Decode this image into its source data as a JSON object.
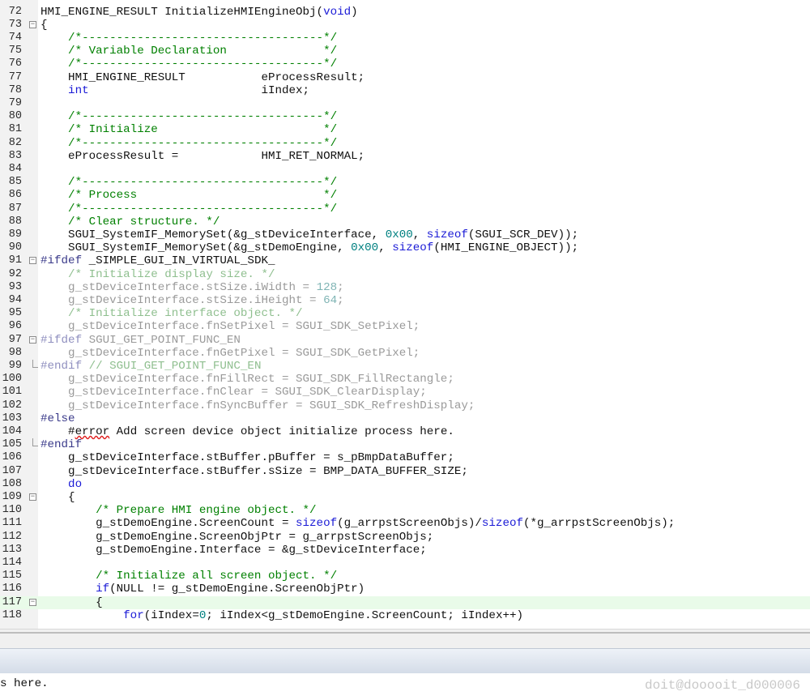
{
  "editor": {
    "first_line": 72,
    "current_line": 117,
    "lines": [
      {
        "n": "72",
        "fold": "none",
        "tokens": [
          [
            "t",
            "HMI_ENGINE_RESULT InitializeHMIEngineObj("
          ],
          [
            "k",
            "void"
          ],
          [
            "t",
            ")"
          ]
        ]
      },
      {
        "n": "73",
        "fold": "open",
        "tokens": [
          [
            "t",
            "{"
          ]
        ]
      },
      {
        "n": "74",
        "fold": "none",
        "tokens": [
          [
            "c",
            "    /*-----------------------------------*/"
          ]
        ]
      },
      {
        "n": "75",
        "fold": "none",
        "tokens": [
          [
            "c",
            "    /* Variable Declaration              */"
          ]
        ]
      },
      {
        "n": "76",
        "fold": "none",
        "tokens": [
          [
            "c",
            "    /*-----------------------------------*/"
          ]
        ]
      },
      {
        "n": "77",
        "fold": "none",
        "tokens": [
          [
            "t",
            "    HMI_ENGINE_RESULT           eProcessResult;"
          ]
        ]
      },
      {
        "n": "78",
        "fold": "none",
        "tokens": [
          [
            "k",
            "    int"
          ],
          [
            "t",
            "                         iIndex;"
          ]
        ]
      },
      {
        "n": "79",
        "fold": "none",
        "tokens": []
      },
      {
        "n": "80",
        "fold": "none",
        "tokens": [
          [
            "c",
            "    /*-----------------------------------*/"
          ]
        ]
      },
      {
        "n": "81",
        "fold": "none",
        "tokens": [
          [
            "c",
            "    /* Initialize                        */"
          ]
        ]
      },
      {
        "n": "82",
        "fold": "none",
        "tokens": [
          [
            "c",
            "    /*-----------------------------------*/"
          ]
        ]
      },
      {
        "n": "83",
        "fold": "none",
        "tokens": [
          [
            "t",
            "    eProcessResult =            HMI_RET_NORMAL;"
          ]
        ]
      },
      {
        "n": "84",
        "fold": "none",
        "tokens": []
      },
      {
        "n": "85",
        "fold": "none",
        "tokens": [
          [
            "c",
            "    /*-----------------------------------*/"
          ]
        ]
      },
      {
        "n": "86",
        "fold": "none",
        "tokens": [
          [
            "c",
            "    /* Process                           */"
          ]
        ]
      },
      {
        "n": "87",
        "fold": "none",
        "tokens": [
          [
            "c",
            "    /*-----------------------------------*/"
          ]
        ]
      },
      {
        "n": "88",
        "fold": "none",
        "tokens": [
          [
            "c",
            "    /* Clear structure. */"
          ]
        ]
      },
      {
        "n": "89",
        "fold": "none",
        "tokens": [
          [
            "t",
            "    SGUI_SystemIF_MemorySet(&g_stDeviceInterface, "
          ],
          [
            "n",
            "0x00"
          ],
          [
            "t",
            ", "
          ],
          [
            "k",
            "sizeof"
          ],
          [
            "t",
            "(SGUI_SCR_DEV));"
          ]
        ]
      },
      {
        "n": "90",
        "fold": "none",
        "tokens": [
          [
            "t",
            "    SGUI_SystemIF_MemorySet(&g_stDemoEngine, "
          ],
          [
            "n",
            "0x00"
          ],
          [
            "t",
            ", "
          ],
          [
            "k",
            "sizeof"
          ],
          [
            "t",
            "(HMI_ENGINE_OBJECT));"
          ]
        ]
      },
      {
        "n": "91",
        "fold": "open",
        "tokens": [
          [
            "p",
            "#ifdef"
          ],
          [
            "t",
            " _SIMPLE_GUI_IN_VIRTUAL_SDK_"
          ]
        ]
      },
      {
        "n": "92",
        "fold": "none",
        "tokens": [
          [
            "gc",
            "    /* Initialize display size. */"
          ]
        ]
      },
      {
        "n": "93",
        "fold": "none",
        "tokens": [
          [
            "g",
            "    g_stDeviceInterface.stSize.iWidth = "
          ],
          [
            "gn",
            "128"
          ],
          [
            "g",
            ";"
          ]
        ]
      },
      {
        "n": "94",
        "fold": "none",
        "tokens": [
          [
            "g",
            "    g_stDeviceInterface.stSize.iHeight = "
          ],
          [
            "gn",
            "64"
          ],
          [
            "g",
            ";"
          ]
        ]
      },
      {
        "n": "95",
        "fold": "none",
        "tokens": [
          [
            "gc",
            "    /* Initialize interface object. */"
          ]
        ]
      },
      {
        "n": "96",
        "fold": "none",
        "tokens": [
          [
            "g",
            "    g_stDeviceInterface.fnSetPixel = SGUI_SDK_SetPixel;"
          ]
        ]
      },
      {
        "n": "97",
        "fold": "open",
        "tokens": [
          [
            "gp",
            "#ifdef"
          ],
          [
            "g",
            " SGUI_GET_POINT_FUNC_EN"
          ]
        ]
      },
      {
        "n": "98",
        "fold": "none",
        "tokens": [
          [
            "g",
            "    g_stDeviceInterface.fnGetPixel = SGUI_SDK_GetPixel;"
          ]
        ]
      },
      {
        "n": "99",
        "fold": "end",
        "tokens": [
          [
            "gp",
            "#endif"
          ],
          [
            "gc",
            " // SGUI_GET_POINT_FUNC_EN"
          ]
        ]
      },
      {
        "n": "100",
        "fold": "none",
        "tokens": [
          [
            "g",
            "    g_stDeviceInterface.fnFillRect = SGUI_SDK_FillRectangle;"
          ]
        ]
      },
      {
        "n": "101",
        "fold": "none",
        "tokens": [
          [
            "g",
            "    g_stDeviceInterface.fnClear = SGUI_SDK_ClearDisplay;"
          ]
        ]
      },
      {
        "n": "102",
        "fold": "none",
        "tokens": [
          [
            "g",
            "    g_stDeviceInterface.fnSyncBuffer = SGUI_SDK_RefreshDisplay;"
          ]
        ]
      },
      {
        "n": "103",
        "fold": "none",
        "tokens": [
          [
            "p",
            "#else"
          ]
        ]
      },
      {
        "n": "104",
        "fold": "none",
        "tokens": [
          [
            "t",
            "    #"
          ],
          [
            "err",
            "error"
          ],
          [
            "t",
            " Add screen device object initialize process here."
          ]
        ]
      },
      {
        "n": "105",
        "fold": "end",
        "tokens": [
          [
            "p",
            "#endif"
          ]
        ]
      },
      {
        "n": "106",
        "fold": "none",
        "tokens": [
          [
            "t",
            "    g_stDeviceInterface.stBuffer.pBuffer = s_pBmpDataBuffer;"
          ]
        ]
      },
      {
        "n": "107",
        "fold": "none",
        "tokens": [
          [
            "t",
            "    g_stDeviceInterface.stBuffer.sSize = BMP_DATA_BUFFER_SIZE;"
          ]
        ]
      },
      {
        "n": "108",
        "fold": "none",
        "tokens": [
          [
            "k",
            "    do"
          ]
        ]
      },
      {
        "n": "109",
        "fold": "open",
        "tokens": [
          [
            "t",
            "    {"
          ]
        ]
      },
      {
        "n": "110",
        "fold": "none",
        "tokens": [
          [
            "c",
            "        /* Prepare HMI engine object. */"
          ]
        ]
      },
      {
        "n": "111",
        "fold": "none",
        "tokens": [
          [
            "t",
            "        g_stDemoEngine.ScreenCount = "
          ],
          [
            "k",
            "sizeof"
          ],
          [
            "t",
            "(g_arrpstScreenObjs)/"
          ],
          [
            "k",
            "sizeof"
          ],
          [
            "t",
            "(*g_arrpstScreenObjs);"
          ]
        ]
      },
      {
        "n": "112",
        "fold": "none",
        "tokens": [
          [
            "t",
            "        g_stDemoEngine.ScreenObjPtr = g_arrpstScreenObjs;"
          ]
        ]
      },
      {
        "n": "113",
        "fold": "none",
        "tokens": [
          [
            "t",
            "        g_stDemoEngine.Interface = &g_stDeviceInterface;"
          ]
        ]
      },
      {
        "n": "114",
        "fold": "none",
        "tokens": []
      },
      {
        "n": "115",
        "fold": "none",
        "tokens": [
          [
            "c",
            "        /* Initialize all screen object. */"
          ]
        ]
      },
      {
        "n": "116",
        "fold": "none",
        "tokens": [
          [
            "k",
            "        if"
          ],
          [
            "t",
            "(NULL != g_stDemoEngine.ScreenObjPtr)"
          ]
        ]
      },
      {
        "n": "117",
        "fold": "open",
        "tokens": [
          [
            "t",
            "        {"
          ]
        ]
      },
      {
        "n": "118",
        "fold": "none",
        "tokens": [
          [
            "t",
            "            "
          ],
          [
            "k",
            "for"
          ],
          [
            "t",
            "(iIndex="
          ],
          [
            "n",
            "0"
          ],
          [
            "t",
            "; iIndex<g_stDemoEngine.ScreenCount; iIndex++)"
          ]
        ]
      }
    ]
  },
  "output": {
    "text": "s here."
  },
  "watermark": {
    "text": "doit@dooooit_d000006"
  }
}
